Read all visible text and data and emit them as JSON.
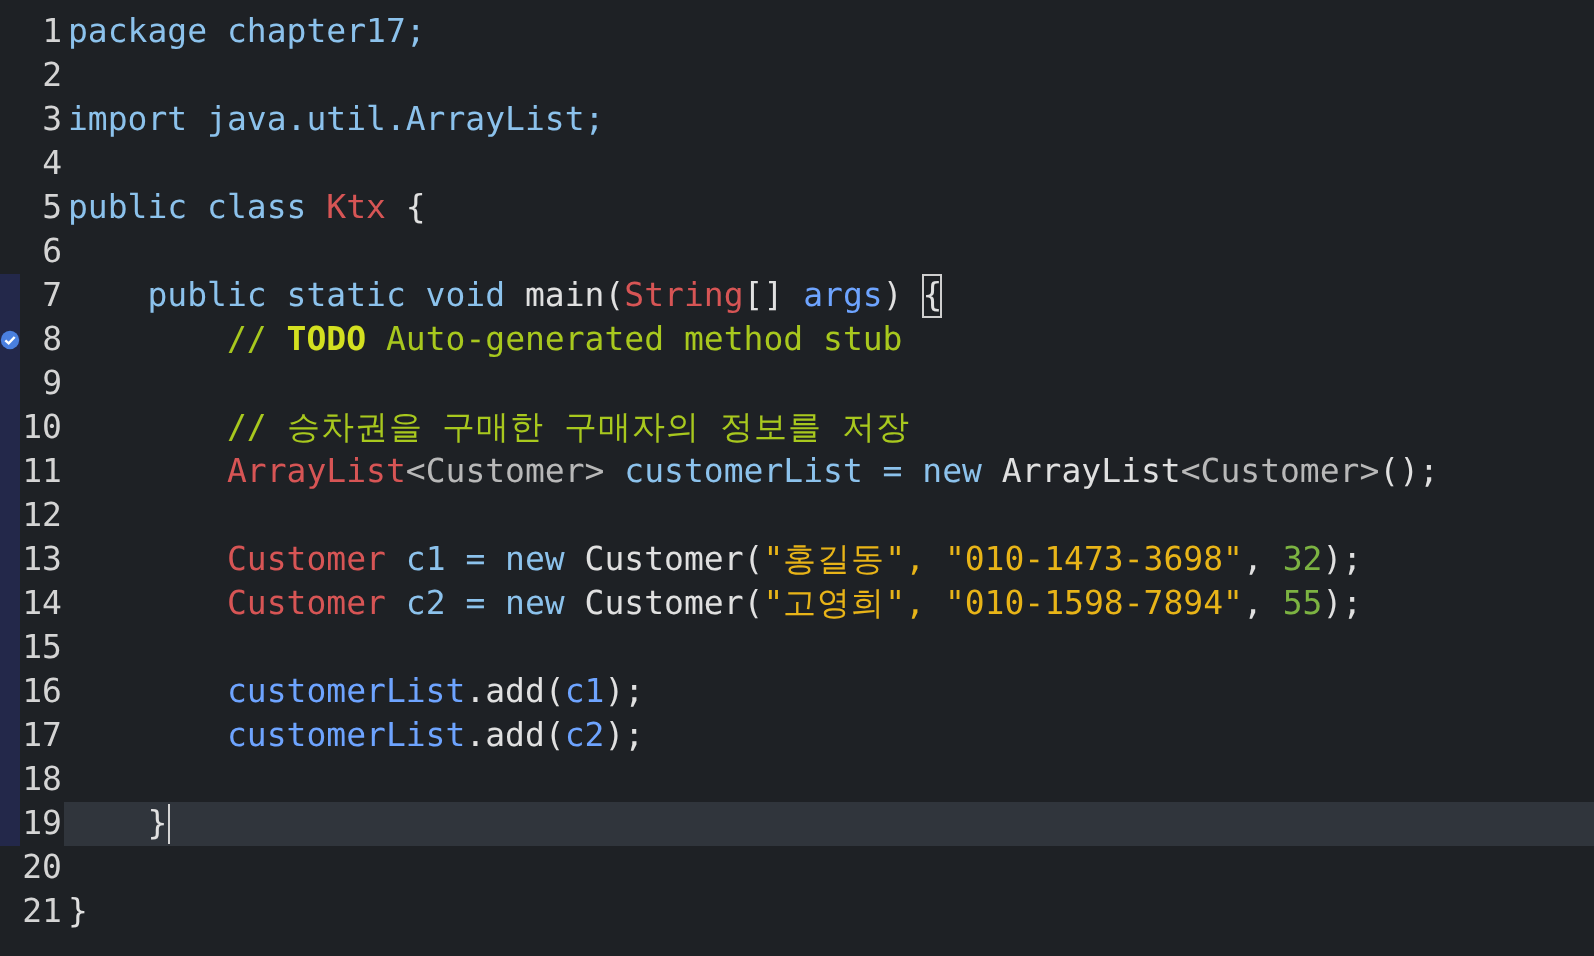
{
  "editor": {
    "lines": [
      {
        "number": "1",
        "current": false,
        "in_range": false,
        "task_marker": false,
        "tokens": [
          {
            "kind": "keyword",
            "text": "package chapter17;"
          }
        ]
      },
      {
        "number": "2",
        "current": false,
        "in_range": false,
        "task_marker": false
      },
      {
        "number": "3",
        "current": false,
        "in_range": false,
        "task_marker": false,
        "tokens": [
          {
            "kind": "keyword",
            "text": "import java.util.ArrayList;"
          }
        ]
      },
      {
        "number": "4",
        "current": false,
        "in_range": false,
        "task_marker": false
      },
      {
        "number": "5",
        "current": false,
        "in_range": false,
        "task_marker": false,
        "tokens": [
          {
            "kind": "keyword",
            "text": "public class "
          },
          {
            "kind": "type",
            "text": "Ktx"
          },
          {
            "kind": "plain",
            "text": " {"
          }
        ]
      },
      {
        "number": "6",
        "current": false,
        "in_range": false,
        "task_marker": false
      },
      {
        "number": "7",
        "current": false,
        "in_range": true,
        "task_marker": false,
        "tokens": [
          {
            "kind": "keyword",
            "text": "    public static void "
          },
          {
            "kind": "plain",
            "text": "main("
          },
          {
            "kind": "type",
            "text": "String"
          },
          {
            "kind": "plain",
            "text": "[] "
          },
          {
            "kind": "variable",
            "text": "args"
          },
          {
            "kind": "plain",
            "text": ") "
          },
          {
            "kind": "bracket-match",
            "text": "{"
          }
        ]
      },
      {
        "number": "8",
        "current": false,
        "in_range": true,
        "task_marker": true,
        "tokens": [
          {
            "kind": "comment",
            "text": "        // "
          },
          {
            "kind": "todo",
            "text": "TODO"
          },
          {
            "kind": "comment",
            "text": " Auto-generated method stub"
          }
        ]
      },
      {
        "number": "9",
        "current": false,
        "in_range": true,
        "task_marker": false
      },
      {
        "number": "10",
        "current": false,
        "in_range": true,
        "task_marker": false,
        "tokens": [
          {
            "kind": "comment",
            "text": "        // 승차권을 구매한 구매자의 정보를 저장"
          }
        ]
      },
      {
        "number": "11",
        "current": false,
        "in_range": true,
        "task_marker": false,
        "tokens": [
          {
            "kind": "type",
            "text": "        ArrayList"
          },
          {
            "kind": "generic",
            "text": "<Customer>"
          },
          {
            "kind": "keyword",
            "text": " customerList = new "
          },
          {
            "kind": "plain",
            "text": "ArrayList"
          },
          {
            "kind": "generic",
            "text": "<Customer>"
          },
          {
            "kind": "plain",
            "text": "();"
          }
        ]
      },
      {
        "number": "12",
        "current": false,
        "in_range": true,
        "task_marker": false
      },
      {
        "number": "13",
        "current": false,
        "in_range": true,
        "task_marker": false,
        "tokens": [
          {
            "kind": "type",
            "text": "        Customer"
          },
          {
            "kind": "keyword",
            "text": " c1 = new "
          },
          {
            "kind": "plain",
            "text": "Customer("
          },
          {
            "kind": "string",
            "text": "\"홍길동\", \"010-1473-3698\""
          },
          {
            "kind": "plain",
            "text": ", "
          },
          {
            "kind": "number",
            "text": "32"
          },
          {
            "kind": "plain",
            "text": ");"
          }
        ]
      },
      {
        "number": "14",
        "current": false,
        "in_range": true,
        "task_marker": false,
        "tokens": [
          {
            "kind": "type",
            "text": "        Customer"
          },
          {
            "kind": "keyword",
            "text": " c2 = new "
          },
          {
            "kind": "plain",
            "text": "Customer("
          },
          {
            "kind": "string",
            "text": "\"고영희\", \"010-1598-7894\""
          },
          {
            "kind": "plain",
            "text": ", "
          },
          {
            "kind": "number",
            "text": "55"
          },
          {
            "kind": "plain",
            "text": ");"
          }
        ]
      },
      {
        "number": "15",
        "current": false,
        "in_range": true,
        "task_marker": false
      },
      {
        "number": "16",
        "current": false,
        "in_range": true,
        "task_marker": false,
        "tokens": [
          {
            "kind": "variable",
            "text": "        customerList"
          },
          {
            "kind": "plain",
            "text": ".add("
          },
          {
            "kind": "variable",
            "text": "c1"
          },
          {
            "kind": "plain",
            "text": ");"
          }
        ]
      },
      {
        "number": "17",
        "current": false,
        "in_range": true,
        "task_marker": false,
        "tokens": [
          {
            "kind": "variable",
            "text": "        customerList"
          },
          {
            "kind": "plain",
            "text": ".add("
          },
          {
            "kind": "variable",
            "text": "c2"
          },
          {
            "kind": "plain",
            "text": ");"
          }
        ]
      },
      {
        "number": "18",
        "current": false,
        "in_range": true,
        "task_marker": false
      },
      {
        "number": "19",
        "current": true,
        "in_range": true,
        "task_marker": false,
        "tokens": [
          {
            "kind": "plain",
            "text": "    }"
          }
        ]
      },
      {
        "number": "20",
        "current": false,
        "in_range": false,
        "task_marker": false
      },
      {
        "number": "21",
        "current": false,
        "in_range": false,
        "task_marker": false,
        "tokens": [
          {
            "kind": "plain",
            "text": "}"
          }
        ]
      }
    ]
  }
}
